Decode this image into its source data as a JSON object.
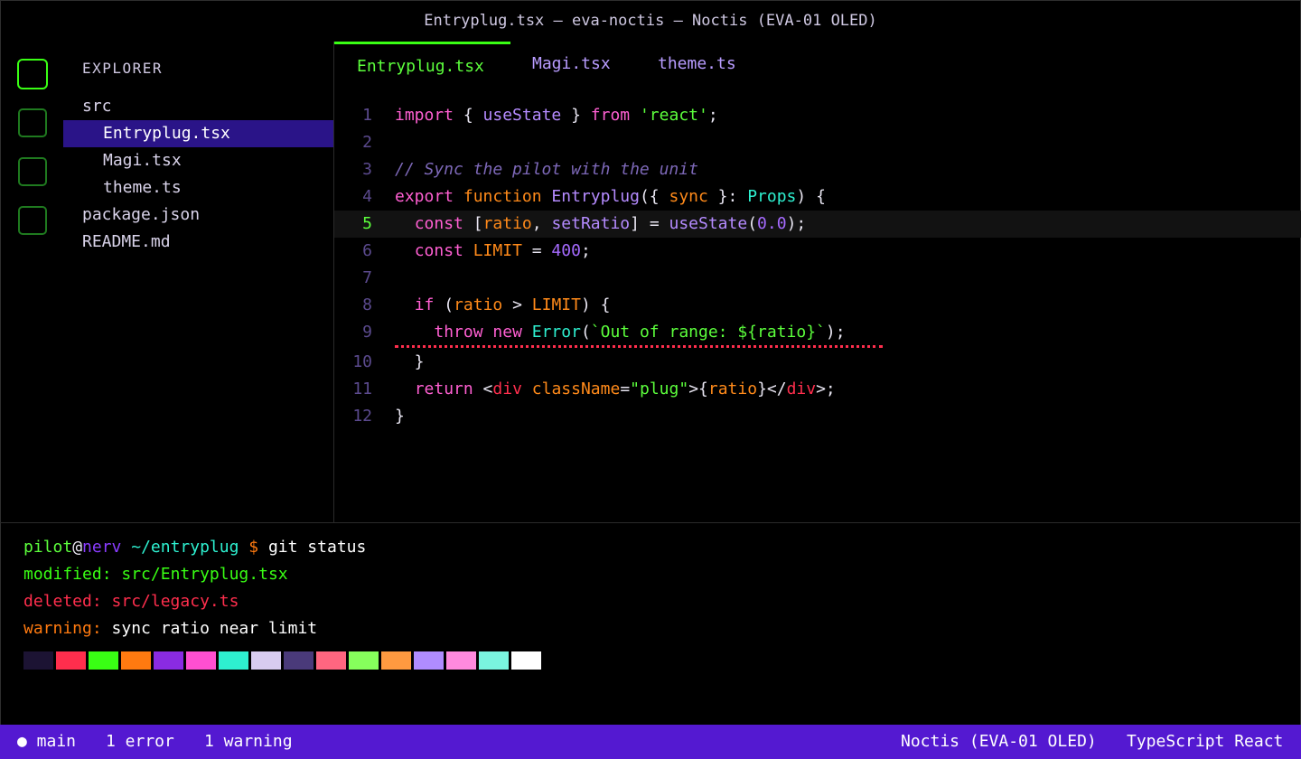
{
  "window": {
    "title": "Entryplug.tsx — eva-noctis — Noctis (EVA-01 OLED)"
  },
  "explorer": {
    "title": "EXPLORER",
    "items": [
      {
        "label": "src"
      },
      {
        "label": "Entryplug.tsx"
      },
      {
        "label": "Magi.tsx"
      },
      {
        "label": "theme.ts"
      },
      {
        "label": "package.json"
      },
      {
        "label": "README.md"
      }
    ]
  },
  "tabs": [
    {
      "label": "Entryplug.tsx"
    },
    {
      "label": "Magi.tsx"
    },
    {
      "label": "theme.ts"
    }
  ],
  "code": {
    "line_numbers": [
      "1",
      "2",
      "3",
      "4",
      "5",
      "6",
      "7",
      "8",
      "9",
      "10",
      "11",
      "12"
    ],
    "lines": [
      [
        [
          "k",
          "import"
        ],
        [
          "p",
          " { "
        ],
        [
          "fn",
          "useState"
        ],
        [
          "p",
          " } "
        ],
        [
          "k",
          "from"
        ],
        [
          "p",
          " "
        ],
        [
          "s",
          "'react'"
        ],
        [
          "p",
          ";"
        ]
      ],
      [],
      [
        [
          "c",
          "// Sync the pilot with the unit"
        ]
      ],
      [
        [
          "k",
          "export"
        ],
        [
          "p",
          " "
        ],
        [
          "kw2",
          "function"
        ],
        [
          "p",
          " "
        ],
        [
          "fn",
          "Entryplug"
        ],
        [
          "p",
          "({ "
        ],
        [
          "v",
          "sync"
        ],
        [
          "p",
          " }: "
        ],
        [
          "fn2",
          "Props"
        ],
        [
          "p",
          ") {"
        ]
      ],
      [
        [
          "p",
          "  "
        ],
        [
          "k",
          "const"
        ],
        [
          "p",
          " ["
        ],
        [
          "v",
          "ratio"
        ],
        [
          "p",
          ", "
        ],
        [
          "fn",
          "setRatio"
        ],
        [
          "p",
          "] = "
        ],
        [
          "fn",
          "useState"
        ],
        [
          "p",
          "("
        ],
        [
          "n",
          "0.0"
        ],
        [
          "p",
          ");"
        ]
      ],
      [
        [
          "p",
          "  "
        ],
        [
          "k",
          "const"
        ],
        [
          "p",
          " "
        ],
        [
          "kw2",
          "LIMIT"
        ],
        [
          "p",
          " = "
        ],
        [
          "n",
          "400"
        ],
        [
          "p",
          ";"
        ]
      ],
      [],
      [
        [
          "p",
          "  "
        ],
        [
          "k",
          "if"
        ],
        [
          "p",
          " ("
        ],
        [
          "v",
          "ratio"
        ],
        [
          "p",
          " > "
        ],
        [
          "kw2",
          "LIMIT"
        ],
        [
          "p",
          ") {"
        ]
      ],
      [
        [
          "p",
          "    "
        ],
        [
          "k",
          "throw"
        ],
        [
          "p",
          " "
        ],
        [
          "k",
          "new"
        ],
        [
          "p",
          " "
        ],
        [
          "fn2",
          "Error"
        ],
        [
          "p",
          "("
        ],
        [
          "s",
          "`Out of range: ${ratio}`"
        ],
        [
          "p",
          ");"
        ]
      ],
      [
        [
          "p",
          "  }"
        ]
      ],
      [
        [
          "p",
          "  "
        ],
        [
          "k",
          "return"
        ],
        [
          "p",
          " <"
        ],
        [
          "tg",
          "div"
        ],
        [
          "p",
          " "
        ],
        [
          "at",
          "className"
        ],
        [
          "p",
          "="
        ],
        [
          "s",
          "\"plug\""
        ],
        [
          "p",
          ">{"
        ],
        [
          "v",
          "ratio"
        ],
        [
          "p",
          "}</"
        ],
        [
          "tg",
          "div"
        ],
        [
          "p",
          ">;"
        ]
      ],
      [
        [
          "p",
          "}"
        ]
      ]
    ]
  },
  "terminal": {
    "prompt_user": "pilot",
    "prompt_at": "@",
    "prompt_host": "nerv",
    "prompt_path": " ~/entryplug",
    "prompt_symbol": " $",
    "command": " git status",
    "modified_label": "modified:",
    "modified_file": " src/Entryplug.tsx",
    "deleted_label": "deleted:",
    "deleted_file": " src/legacy.ts",
    "warning_label": "warning:",
    "warning_text": " sync ratio near limit",
    "palette": [
      "#1c1333",
      "#ff2e4d",
      "#39ff14",
      "#ff7a10",
      "#8a2be2",
      "#ff4fd1",
      "#2ef0d0",
      "#d8ccf0",
      "#4a3a7a",
      "#ff6680",
      "#86ff5c",
      "#ff9a40",
      "#b08cff",
      "#ff8ade",
      "#7af5df",
      "#ffffff"
    ]
  },
  "status": {
    "branch": "● main",
    "errors": "1 error",
    "warnings": "1 warning",
    "theme": "Noctis (EVA-01 OLED)",
    "language": "TypeScript React"
  },
  "colors": {
    "accent": "#39ff14",
    "statusbar": "#5419d1",
    "selection": "#2a1488"
  }
}
